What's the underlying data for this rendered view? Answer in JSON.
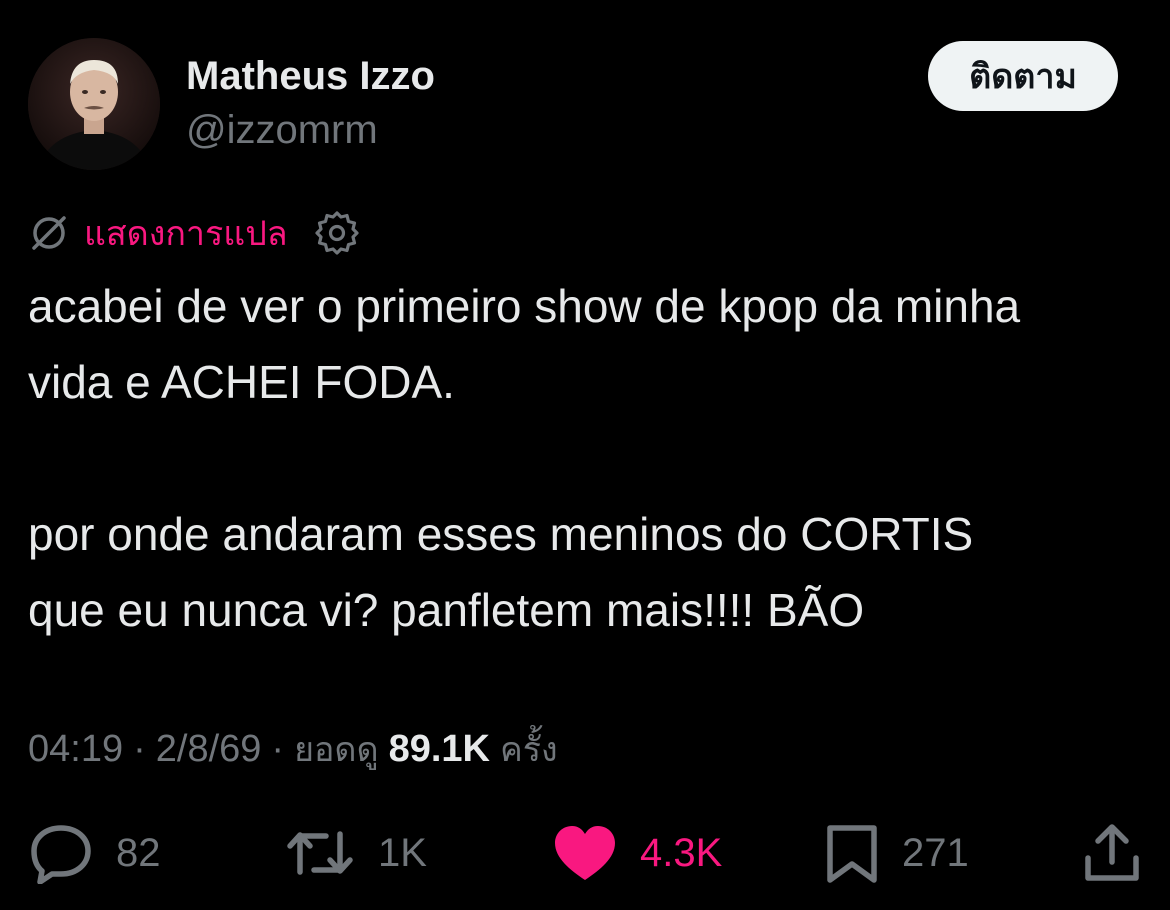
{
  "user": {
    "display_name": "Matheus Izzo",
    "handle": "@izzomrm",
    "follow_label": "ติดตาม",
    "avatar_icon": "avatar-photo"
  },
  "translate": {
    "label": "แสดงการแปล",
    "icon": "globe-slash-icon",
    "settings_icon": "gear-icon"
  },
  "tweet": {
    "lines": [
      "acabei de ver o primeiro show de kpop da minha",
      "vida e ACHEI FODA.",
      "",
      "por onde andaram esses meninos do CORTIS",
      "que eu nunca vi? panfletem mais!!!! BÃO"
    ]
  },
  "meta": {
    "time": "04:19",
    "separator": "·",
    "date": "2/8/69",
    "views_label": "ยอดดู",
    "views_count": "89.1K",
    "views_suffix": "ครั้ง"
  },
  "actions": {
    "reply": {
      "icon": "reply-icon",
      "count": "82"
    },
    "retweet": {
      "icon": "retweet-icon",
      "count": "1K"
    },
    "like": {
      "icon": "heart-icon",
      "count": "4.3K",
      "liked": true
    },
    "bookmark": {
      "icon": "bookmark-icon",
      "count": "271"
    },
    "share": {
      "icon": "share-icon"
    }
  },
  "colors": {
    "background": "#000000",
    "text": "#e7e9ea",
    "muted": "#71767b",
    "accent_pink": "#f91880",
    "button_bg": "#eff3f4"
  }
}
